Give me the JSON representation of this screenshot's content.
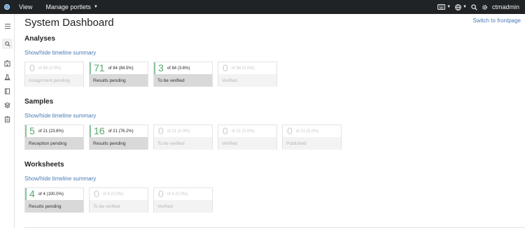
{
  "topbar": {
    "menu": [
      {
        "label": "View"
      },
      {
        "label": "Manage portlets"
      }
    ],
    "user": "ctmadmin"
  },
  "sidebar": {
    "icons": [
      "menu-icon",
      "search-icon",
      "building-icon",
      "flask-icon",
      "book-icon",
      "layers-icon",
      "clipboard-icon"
    ]
  },
  "page": {
    "title": "System Dashboard",
    "frontpage_link": "Switch to frontpage"
  },
  "sections": [
    {
      "title": "Analyses",
      "toggle": "Show/hide timeline summary",
      "tiles": [
        {
          "num": "0",
          "of": "of 84 (0.0%)",
          "label": "Assignment pending",
          "active": false
        },
        {
          "num": "71",
          "of": "of 84 (84.5%)",
          "label": "Results pending",
          "active": true
        },
        {
          "num": "3",
          "of": "of 84 (3.6%)",
          "label": "To be verified",
          "active": true
        },
        {
          "num": "0",
          "of": "of 84 (0.0%)",
          "label": "Verified",
          "active": false
        }
      ]
    },
    {
      "title": "Samples",
      "toggle": "Show/hide timeline summary",
      "tiles": [
        {
          "num": "5",
          "of": "of 21 (23.8%)",
          "label": "Reception pending",
          "active": true
        },
        {
          "num": "16",
          "of": "of 21 (76.2%)",
          "label": "Results pending",
          "active": true
        },
        {
          "num": "0",
          "of": "of 21 (0.0%)",
          "label": "To be verified",
          "active": false
        },
        {
          "num": "0",
          "of": "of 21 (0.0%)",
          "label": "Verified",
          "active": false
        },
        {
          "num": "0",
          "of": "of 21 (0.0%)",
          "label": "Published",
          "active": false
        }
      ]
    },
    {
      "title": "Worksheets",
      "toggle": "Show/hide timeline summary",
      "tiles": [
        {
          "num": "4",
          "of": "of 4 (100.0%)",
          "label": "Results pending",
          "active": true
        },
        {
          "num": "0",
          "of": "of 4 (0.0%)",
          "label": "To be verified",
          "active": false
        },
        {
          "num": "0",
          "of": "of 4 (0.0%)",
          "label": "Verified",
          "active": false
        }
      ]
    }
  ]
}
